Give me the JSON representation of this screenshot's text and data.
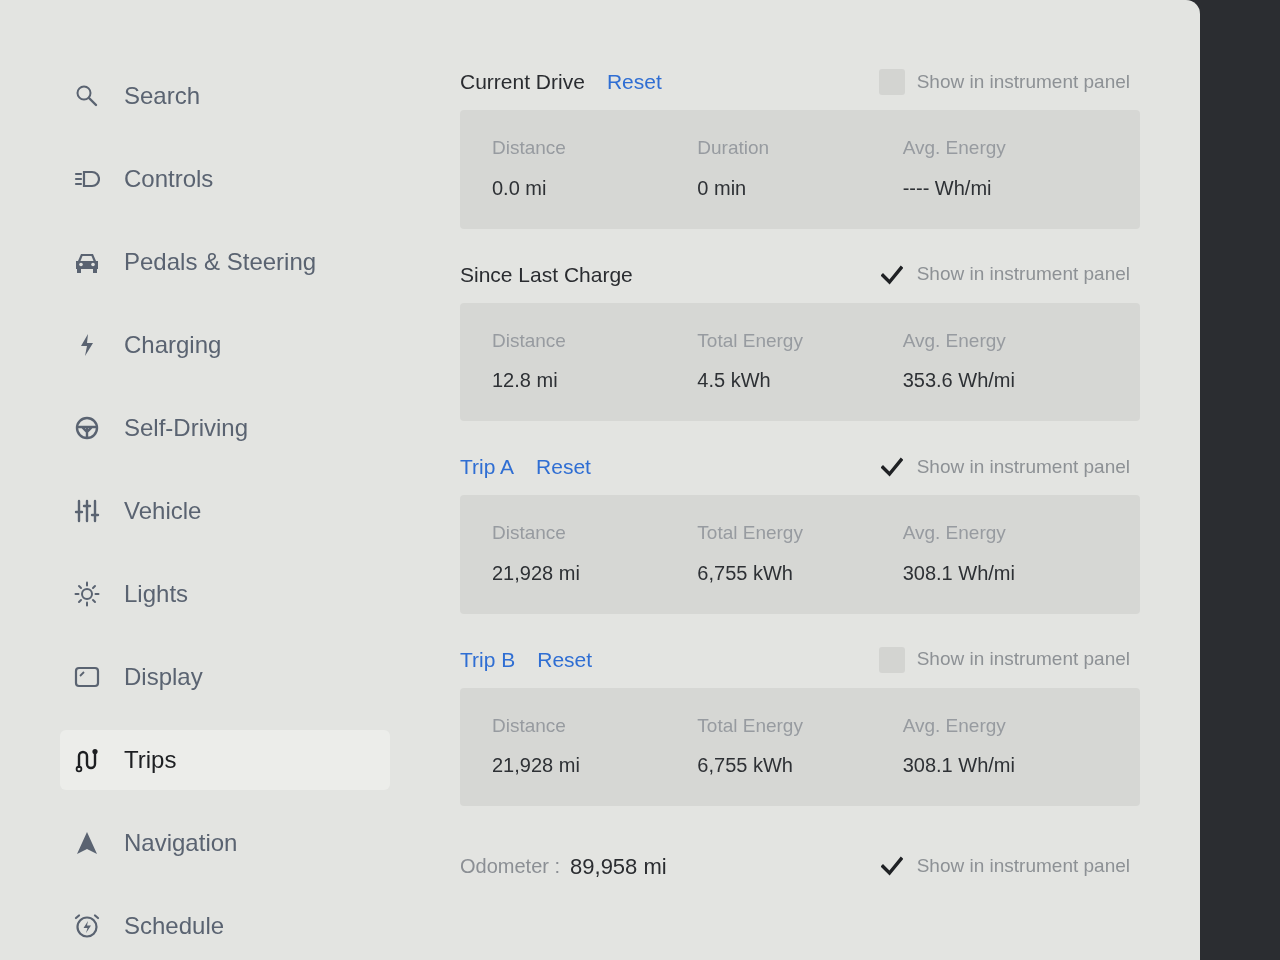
{
  "sidebar": {
    "items": [
      {
        "label": "Search",
        "selected": false
      },
      {
        "label": "Controls",
        "selected": false
      },
      {
        "label": "Pedals & Steering",
        "selected": false
      },
      {
        "label": "Charging",
        "selected": false
      },
      {
        "label": "Self-Driving",
        "selected": false
      },
      {
        "label": "Vehicle",
        "selected": false
      },
      {
        "label": "Lights",
        "selected": false
      },
      {
        "label": "Display",
        "selected": false
      },
      {
        "label": "Trips",
        "selected": true
      },
      {
        "label": "Navigation",
        "selected": false
      },
      {
        "label": "Schedule",
        "selected": false
      }
    ]
  },
  "sections": [
    {
      "title": "Current Drive",
      "title_link": false,
      "reset": "Reset",
      "show_in_panel": {
        "label": "Show in instrument panel",
        "checked": false
      },
      "stats": [
        {
          "label": "Distance",
          "value": "0.0 mi"
        },
        {
          "label": "Duration",
          "value": "0 min"
        },
        {
          "label": "Avg. Energy",
          "value": "---- Wh/mi"
        }
      ]
    },
    {
      "title": "Since Last Charge",
      "title_link": false,
      "show_in_panel": {
        "label": "Show in instrument panel",
        "checked": true
      },
      "stats": [
        {
          "label": "Distance",
          "value": "12.8 mi"
        },
        {
          "label": "Total Energy",
          "value": "4.5 kWh"
        },
        {
          "label": "Avg. Energy",
          "value": "353.6 Wh/mi"
        }
      ]
    },
    {
      "title": "Trip A",
      "title_link": true,
      "reset": "Reset",
      "show_in_panel": {
        "label": "Show in instrument panel",
        "checked": true
      },
      "stats": [
        {
          "label": "Distance",
          "value": "21,928 mi"
        },
        {
          "label": "Total Energy",
          "value": "6,755 kWh"
        },
        {
          "label": "Avg. Energy",
          "value": "308.1 Wh/mi"
        }
      ]
    },
    {
      "title": "Trip B",
      "title_link": true,
      "reset": "Reset",
      "show_in_panel": {
        "label": "Show in instrument panel",
        "checked": false
      },
      "stats": [
        {
          "label": "Distance",
          "value": "21,928 mi"
        },
        {
          "label": "Total Energy",
          "value": "6,755 kWh"
        },
        {
          "label": "Avg. Energy",
          "value": "308.1 Wh/mi"
        }
      ]
    }
  ],
  "odometer": {
    "label": "Odometer :",
    "value": "89,958 mi",
    "show_in_panel": {
      "label": "Show in instrument panel",
      "checked": true
    }
  }
}
